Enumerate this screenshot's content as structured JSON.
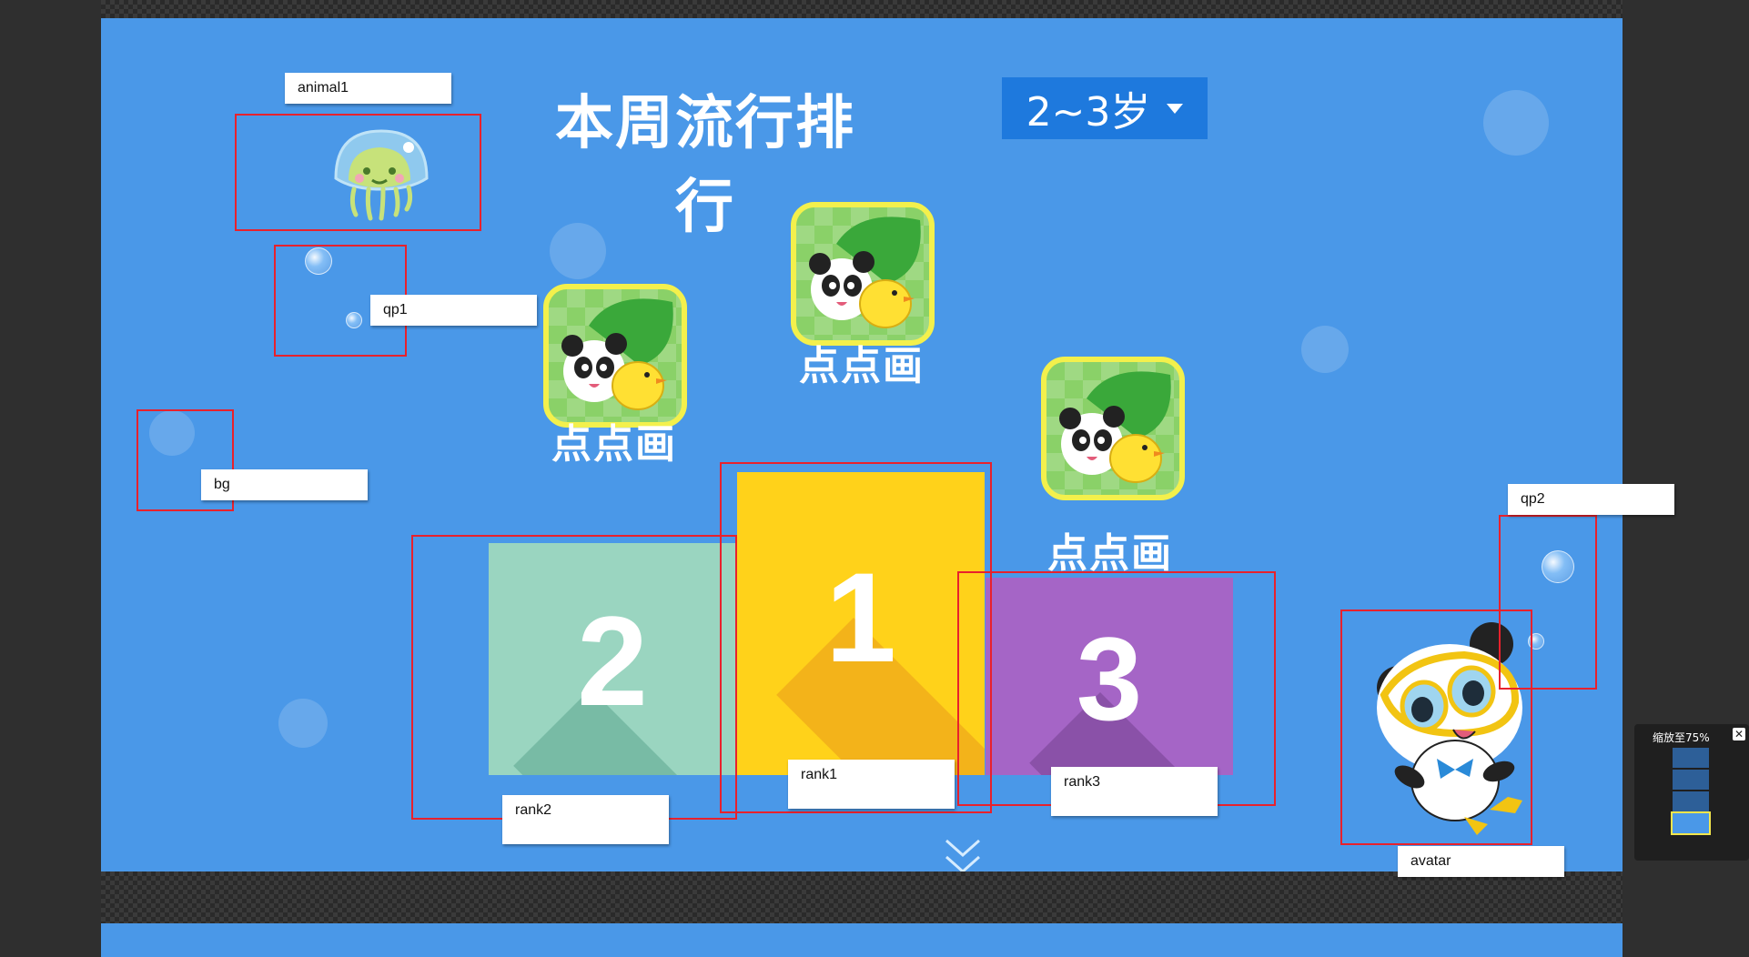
{
  "page": {
    "title": "本周流行排行",
    "age_filter": {
      "value": "2~3岁"
    }
  },
  "apps": [
    {
      "rank": "1",
      "name": "点点画"
    },
    {
      "rank": "2",
      "name": "点点画"
    },
    {
      "rank": "3",
      "name": "点点画"
    }
  ],
  "layer_tags": {
    "animal1": "animal1",
    "qp1": "qp1",
    "bg": "bg",
    "qp2": "qp2",
    "rank1": "rank1",
    "rank2": "rank2",
    "rank3": "rank3",
    "avatar": "avatar"
  },
  "navigator": {
    "zoom_label": "缩放至75%",
    "close": "✕"
  },
  "colors": {
    "stage_bg": "#4a98e8",
    "rank1": "#ffd21a",
    "rank2": "#9ad5c0",
    "rank3": "#a565c6",
    "select_bg": "#1e79dd",
    "highlight_box": "#e8212c"
  },
  "icons": [
    "jellyfish-icon",
    "panda-duck-app-icon",
    "chevron-double-down-icon",
    "diver-panda-avatar"
  ]
}
